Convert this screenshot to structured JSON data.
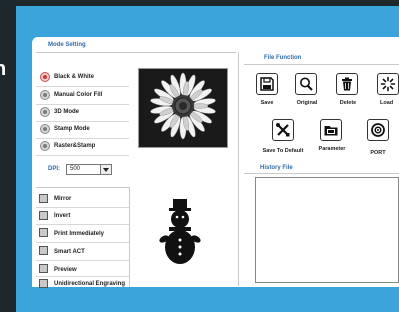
{
  "outer_letter": "n",
  "mode_setting": {
    "title": "Mode Setting",
    "options": [
      {
        "label": "Black & White",
        "selected": true
      },
      {
        "label": "Manual Color Fill",
        "selected": false
      },
      {
        "label": "3D Mode",
        "selected": false
      },
      {
        "label": "Stamp Mode",
        "selected": false
      },
      {
        "label": "Raster&Stamp",
        "selected": false
      }
    ]
  },
  "dpi": {
    "label": "DPI:",
    "value": "500"
  },
  "checkboxes": [
    {
      "label": "Mirror"
    },
    {
      "label": "Invert"
    },
    {
      "label": "Print Immediately"
    },
    {
      "label": "Smart ACT"
    },
    {
      "label": "Preview"
    },
    {
      "label": "Unidirectional Engraving"
    }
  ],
  "file_function": {
    "title": "File Function",
    "row1": [
      {
        "label": "Save",
        "icon": "floppy-disk-icon"
      },
      {
        "label": "Original",
        "icon": "magnifier-icon"
      },
      {
        "label": "Delete",
        "icon": "trash-can-icon"
      },
      {
        "label": "Load",
        "icon": "load-spinner-icon"
      }
    ],
    "row2": [
      {
        "label": "Save To Default",
        "icon": "tools-icon"
      },
      {
        "label": "Parameter",
        "icon": "folder-icon"
      },
      {
        "label": "PORT",
        "icon": "port-icon"
      }
    ]
  },
  "history_file": {
    "title": "History File"
  },
  "colors": {
    "frame": "#3aa5db",
    "background": "#1e272c",
    "header_text": "#2e6ea8",
    "selected_radio": "#c93a3a"
  }
}
